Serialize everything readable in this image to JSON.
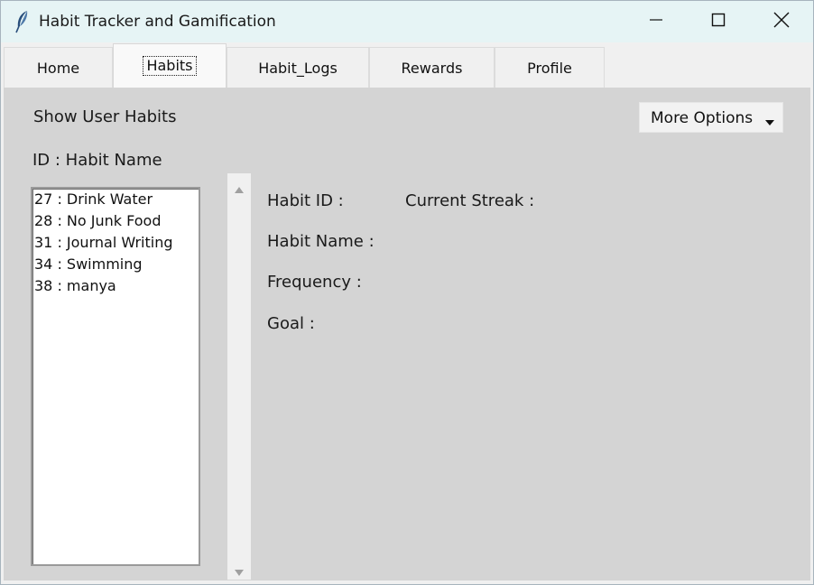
{
  "window": {
    "title": "Habit Tracker and Gamification",
    "icon": "feather-icon",
    "controls": [
      "minimize-icon",
      "maximize-icon",
      "close-icon"
    ]
  },
  "tabs": [
    {
      "label": "Home",
      "active": false
    },
    {
      "label": "Habits",
      "active": true
    },
    {
      "label": "Habit_Logs",
      "active": false
    },
    {
      "label": "Rewards",
      "active": false
    },
    {
      "label": "Profile",
      "active": false
    }
  ],
  "panel": {
    "heading": "Show User Habits",
    "list_header": "ID : Habit Name",
    "more_options": {
      "label": "More Options",
      "icon": "caret-down-icon"
    },
    "habits": [
      "27 : Drink Water",
      "28 : No Junk Food",
      "31 : Journal Writing",
      "34 : Swimming",
      "38 : manya"
    ],
    "details": {
      "habit_id_label": "Habit ID :",
      "current_streak_label": "Current Streak :",
      "habit_name_label": "Habit Name :",
      "frequency_label": "Frequency :",
      "goal_label": "Goal :"
    }
  },
  "colors": {
    "titlebar": "#e6f4f5",
    "panel": "#d4d4d4",
    "tabbar": "#f0f0f0"
  }
}
